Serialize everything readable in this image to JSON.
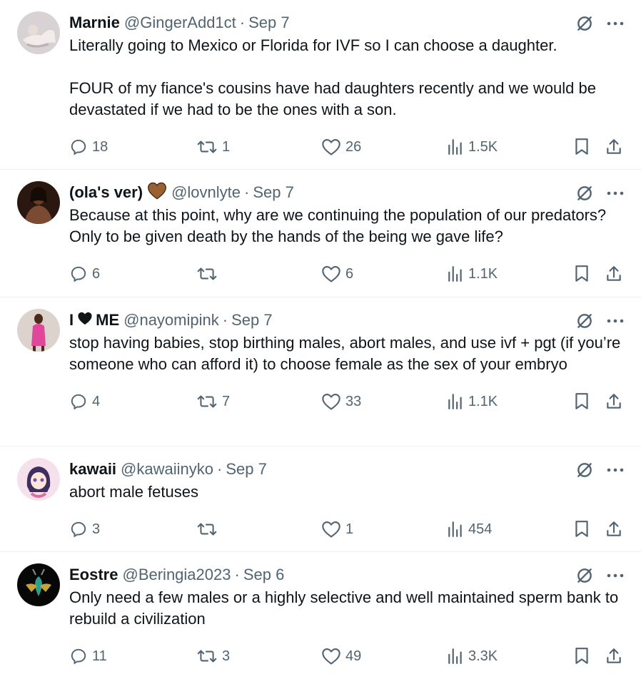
{
  "tweets": [
    {
      "name": "Marnie",
      "name_suffix": "",
      "handle": "@GingerAdd1ct",
      "dot": "·",
      "date": "Sep 7",
      "text": "Literally going to Mexico or Florida for IVF so I can choose a daughter.\n\nFOUR of my fiance's cousins have had daughters recently and we would be devastated if we had to be the ones with a son.",
      "replies": "18",
      "retweets": "1",
      "likes": "26",
      "views": "1.5K",
      "avatar_icon": "avatar-photo-pale",
      "avatar_colors": [
        "#c9c4c8",
        "#e9e3e6"
      ]
    },
    {
      "name": "(ola's ver)",
      "name_suffix": "",
      "name_heart": "brown-heart-emoji",
      "handle": "@lovnlyte",
      "dot": "·",
      "date": "Sep 7",
      "text": "Because at this point, why are we continuing the population of our predators? Only to be given death by the hands of the being we gave life?",
      "replies": "6",
      "retweets": "",
      "likes": "6",
      "views": "1.1K",
      "avatar_icon": "avatar-photo-dark",
      "avatar_colors": [
        "#3b2418",
        "#7a4a32"
      ]
    },
    {
      "name": "I",
      "name_suffix": "ME",
      "name_heart": "black-heart-emoji",
      "handle": "@nayomipink",
      "dot": "·",
      "date": "Sep 7",
      "text": "stop having babies, stop birthing males, abort males, and use ivf + pgt (if you’re someone who can afford it) to choose female as the sex of your embryo",
      "replies": "4",
      "retweets": "7",
      "likes": "33",
      "views": "1.1K",
      "avatar_icon": "avatar-photo-pink-dress",
      "avatar_colors": [
        "#d9cfc9",
        "#e0479a"
      ]
    },
    {
      "name": "kawaii",
      "name_suffix": "",
      "handle": "@kawaiinyko",
      "dot": "·",
      "date": "Sep 7",
      "text": "abort male fetuses",
      "replies": "3",
      "retweets": "",
      "likes": "1",
      "views": "454",
      "avatar_icon": "avatar-anime",
      "avatar_colors": [
        "#f3d6e6",
        "#4b3a6e"
      ]
    },
    {
      "name": "Eostre",
      "name_suffix": "",
      "handle": "@Beringia2023",
      "dot": "·",
      "date": "Sep 6",
      "text": "Only need a few males or a highly selective and well maintained sperm bank to rebuild a civilization",
      "replies": "11",
      "retweets": "3",
      "likes": "49",
      "views": "3.3K",
      "avatar_icon": "avatar-beetle",
      "avatar_colors": [
        "#0a0a0a",
        "#2e9e8c"
      ]
    }
  ],
  "colors": {
    "text": "#0f1419",
    "secondary": "#536471",
    "divider": "#eff3f4"
  }
}
